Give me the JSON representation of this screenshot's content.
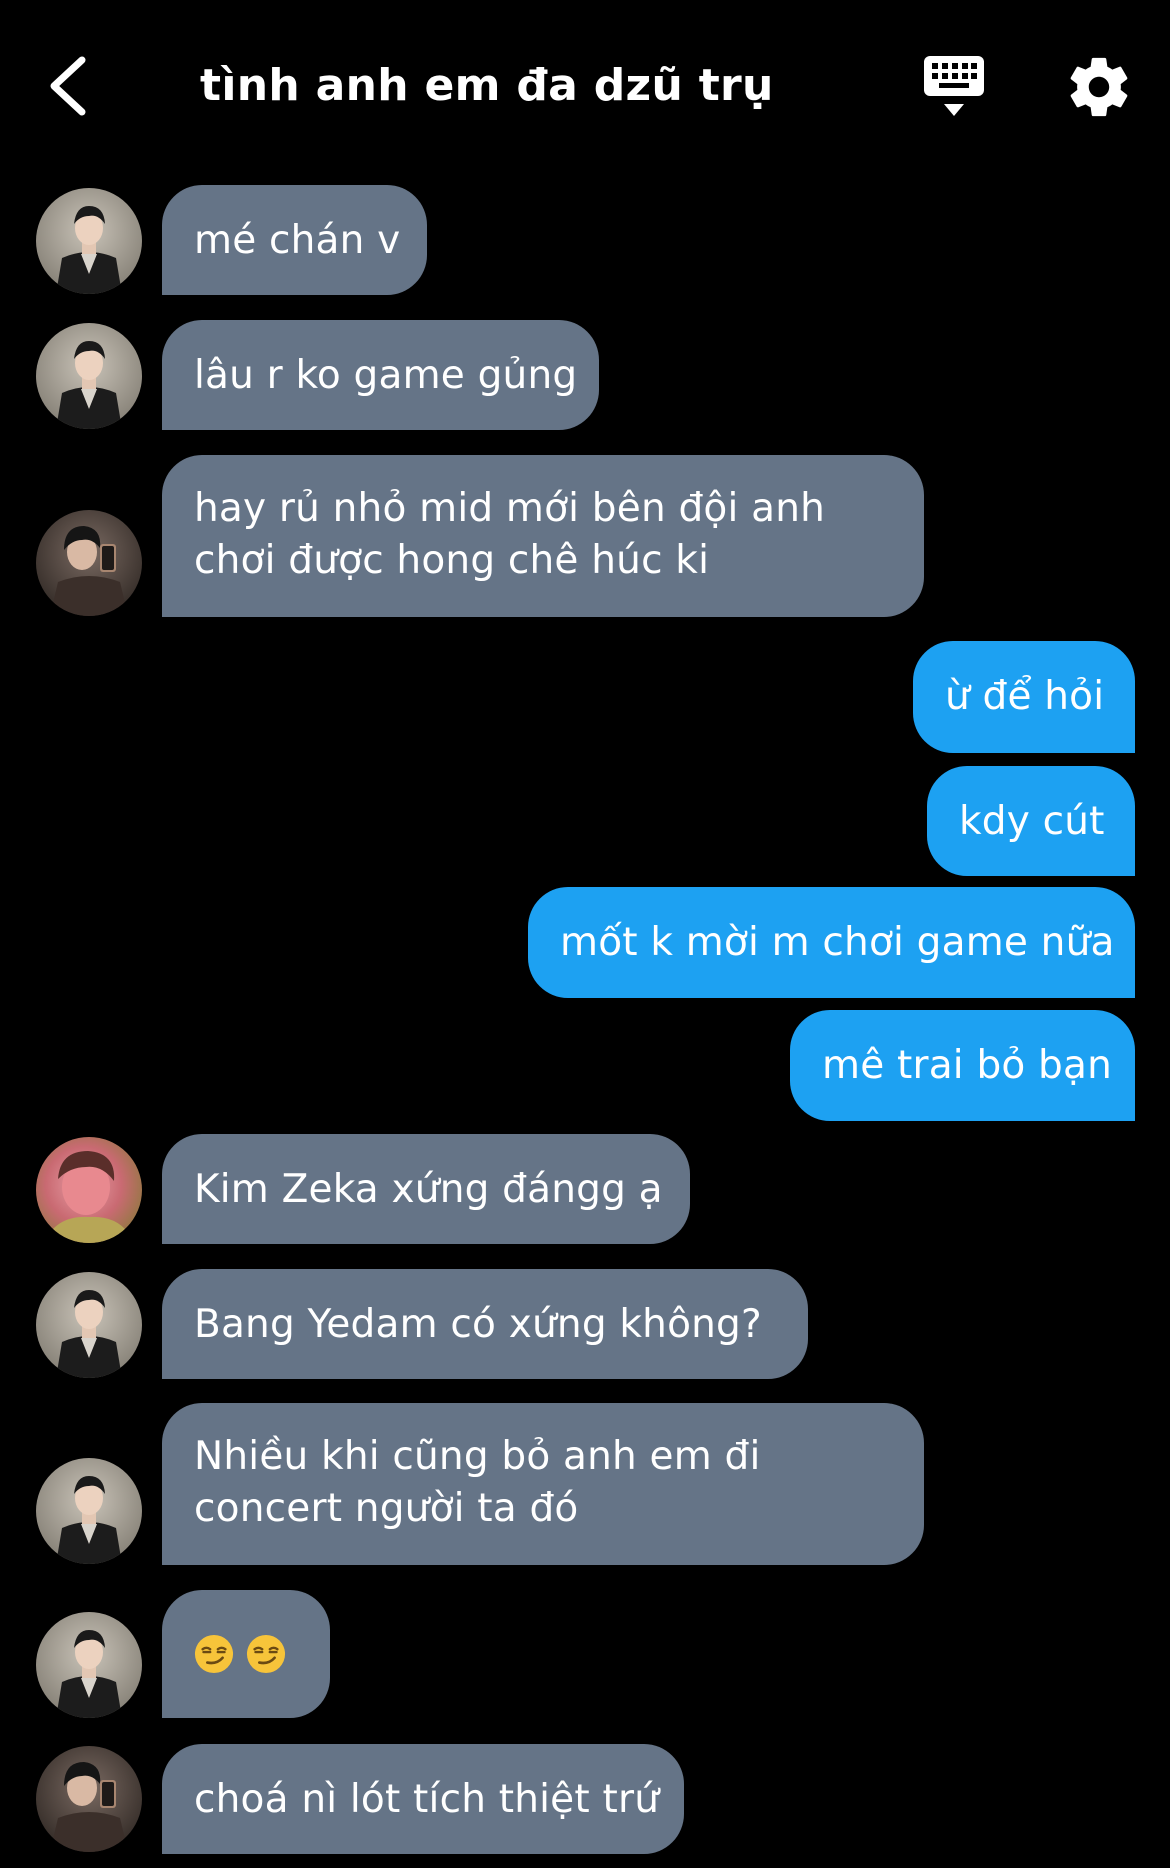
{
  "header": {
    "title": "tình anh em đa dzũ trụ",
    "back_icon": "chevron-left-icon",
    "keyboard_icon": "keyboard-icon",
    "settings_icon": "gear-icon"
  },
  "colors": {
    "background": "#000000",
    "incoming_bubble": "#657487",
    "outgoing_bubble": "#1da1f2",
    "text": "#ffffff"
  },
  "messages": [
    {
      "side": "in",
      "avatar": "avatar-leather-jacket",
      "text": "mé chán v"
    },
    {
      "side": "in",
      "avatar": "avatar-leather-jacket",
      "text": "lâu r ko game gủng"
    },
    {
      "side": "in",
      "avatar": "avatar-mirror-selfie",
      "line1": "hay rủ nhỏ mid mới bên đội anh",
      "line2": "chơi được hong chê húc ki"
    },
    {
      "side": "out",
      "text": "ừ để hỏi"
    },
    {
      "side": "out",
      "text": "kdy cút"
    },
    {
      "side": "out",
      "text": "mốt k mời m chơi game nữa"
    },
    {
      "side": "out",
      "text": "mê trai bỏ bạn"
    },
    {
      "side": "in",
      "avatar": "avatar-red-face",
      "text": "Kim Zeka xứng đángg ạ"
    },
    {
      "side": "in",
      "avatar": "avatar-leather-jacket",
      "text": "Bang Yedam có xứng không?"
    },
    {
      "side": "in",
      "avatar": "avatar-leather-jacket",
      "line1": "Nhiều khi cũng bỏ anh em đi",
      "line2": "concert người ta đó"
    },
    {
      "side": "in",
      "avatar": "avatar-leather-jacket",
      "emoji": "smirking-face-emoji",
      "text": "😏 😏"
    },
    {
      "side": "in",
      "avatar": "avatar-mirror-selfie",
      "text": "choá nì lót tích thiệt trứ"
    }
  ]
}
